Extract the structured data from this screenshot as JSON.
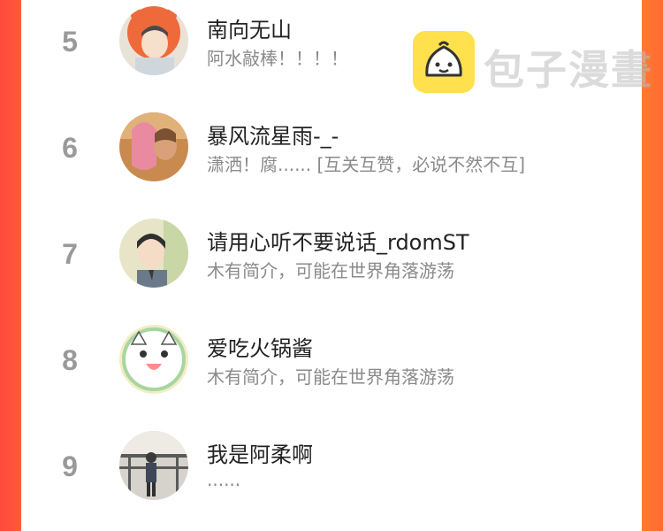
{
  "rankings": [
    {
      "rank": "5",
      "name": "南向无山",
      "bio": "阿水敲棒！！！！"
    },
    {
      "rank": "6",
      "name": "暴风流星雨-_-",
      "bio": "潇洒！腐...... [互关互赞，必说不然不互]"
    },
    {
      "rank": "7",
      "name": "请用心听不要说话_rdomST",
      "bio": "木有简介，可能在世界角落游荡"
    },
    {
      "rank": "8",
      "name": "爱吃火锅酱",
      "bio": "木有简介，可能在世界角落游荡"
    },
    {
      "rank": "9",
      "name": "我是阿柔啊",
      "bio": "......"
    }
  ],
  "watermark": {
    "text": "包子漫畫",
    "icon": "bun-mascot-icon"
  },
  "colors": {
    "left_border": "#ff4a3d",
    "right_border": "#ff7a33",
    "rank": "#9a9a9a",
    "name": "#222222",
    "bio": "#8a8a8a"
  }
}
